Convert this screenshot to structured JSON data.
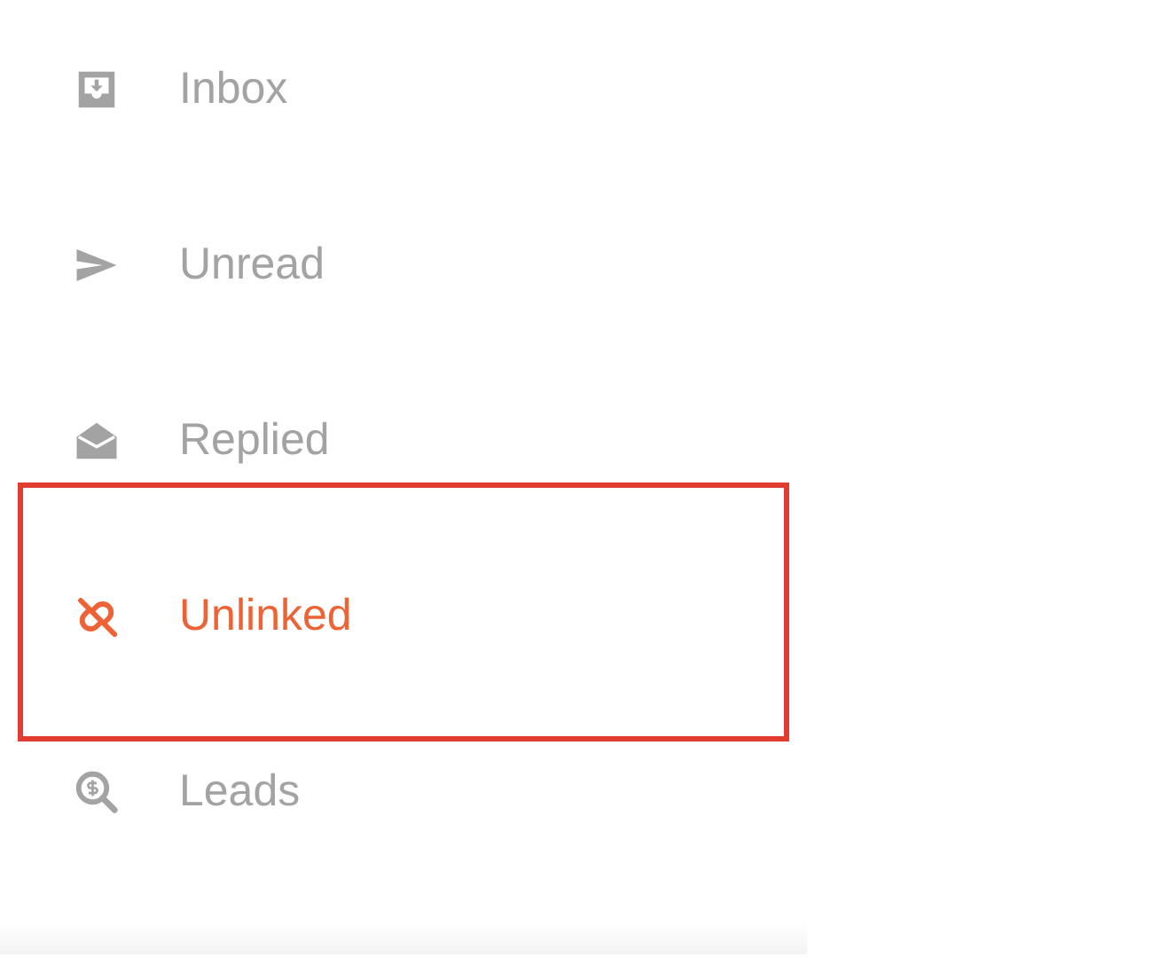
{
  "menu": {
    "items": [
      {
        "label": "Inbox",
        "selected": false
      },
      {
        "label": "Unread",
        "selected": false
      },
      {
        "label": "Replied",
        "selected": false
      },
      {
        "label": "Unlinked",
        "selected": true
      },
      {
        "label": "Leads",
        "selected": false
      }
    ]
  }
}
